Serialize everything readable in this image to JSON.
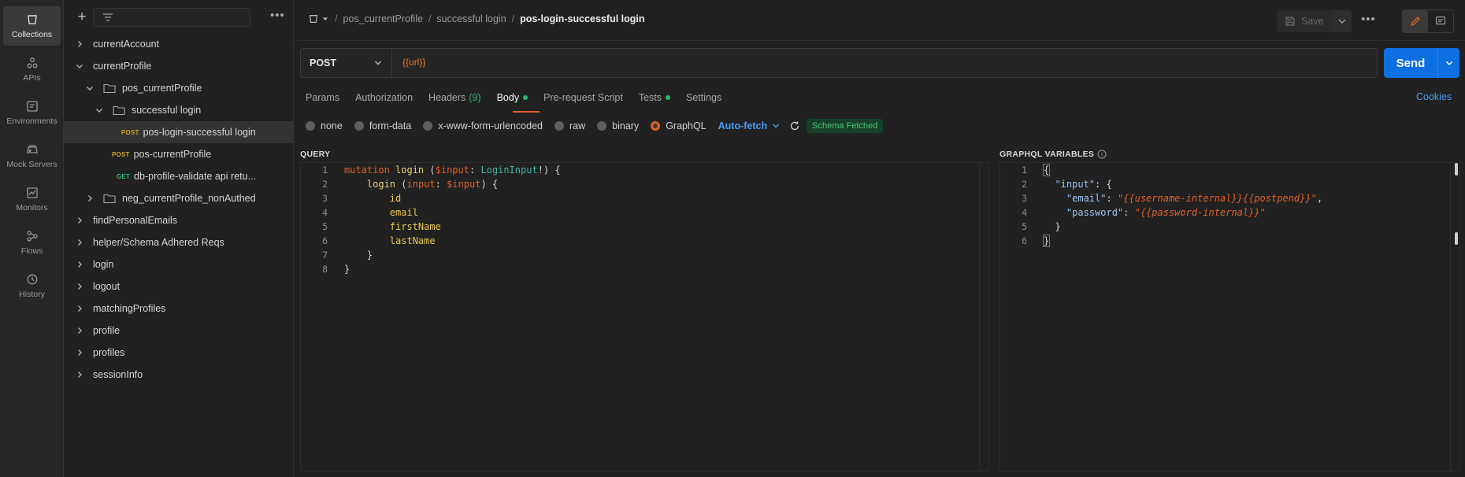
{
  "rail": [
    {
      "icon": "collections-icon",
      "label": "Collections",
      "active": true
    },
    {
      "icon": "apis-icon",
      "label": "APIs"
    },
    {
      "icon": "environments-icon",
      "label": "Environments"
    },
    {
      "icon": "mock-servers-icon",
      "label": "Mock Servers"
    },
    {
      "icon": "monitors-icon",
      "label": "Monitors"
    },
    {
      "icon": "flows-icon",
      "label": "Flows"
    },
    {
      "icon": "history-icon",
      "label": "History"
    }
  ],
  "tree": [
    {
      "label": "currentAccount"
    },
    {
      "label": "currentProfile"
    },
    {
      "label": "pos_currentProfile"
    },
    {
      "label": "successful login"
    },
    {
      "method": "POST",
      "label": "pos-login-successful login"
    },
    {
      "method": "POST",
      "label": "pos-currentProfile"
    },
    {
      "method": "GET",
      "label": "db-profile-validate api retu..."
    },
    {
      "label": "neg_currentProfile_nonAuthed"
    },
    {
      "label": "findPersonalEmails"
    },
    {
      "label": "helper/Schema Adhered Reqs"
    },
    {
      "label": "login"
    },
    {
      "label": "logout"
    },
    {
      "label": "matchingProfiles"
    },
    {
      "label": "profile"
    },
    {
      "label": "profiles"
    },
    {
      "label": "sessionInfo"
    }
  ],
  "breadcrumb": {
    "items": [
      "pos_currentProfile",
      "successful login"
    ],
    "current": "pos-login-successful login"
  },
  "toolbar": {
    "save_label": "Save",
    "more": "•••"
  },
  "request": {
    "method": "POST",
    "url": "{{url}}",
    "send_label": "Send"
  },
  "tabs": {
    "params": "Params",
    "authorization": "Authorization",
    "headers": "Headers",
    "headers_count": "(9)",
    "body": "Body",
    "prerequest": "Pre-request Script",
    "tests": "Tests",
    "settings": "Settings",
    "cookies": "Cookies"
  },
  "body_types": {
    "none": "none",
    "form_data": "form-data",
    "urlencoded": "x-www-form-urlencoded",
    "raw": "raw",
    "binary": "binary",
    "graphql": "GraphQL",
    "autofetch": "Auto-fetch",
    "schema_status": "Schema Fetched"
  },
  "query": {
    "label": "QUERY",
    "line_count": 8
  },
  "variables": {
    "label": "GRAPHQL VARIABLES",
    "line_count": 6
  }
}
